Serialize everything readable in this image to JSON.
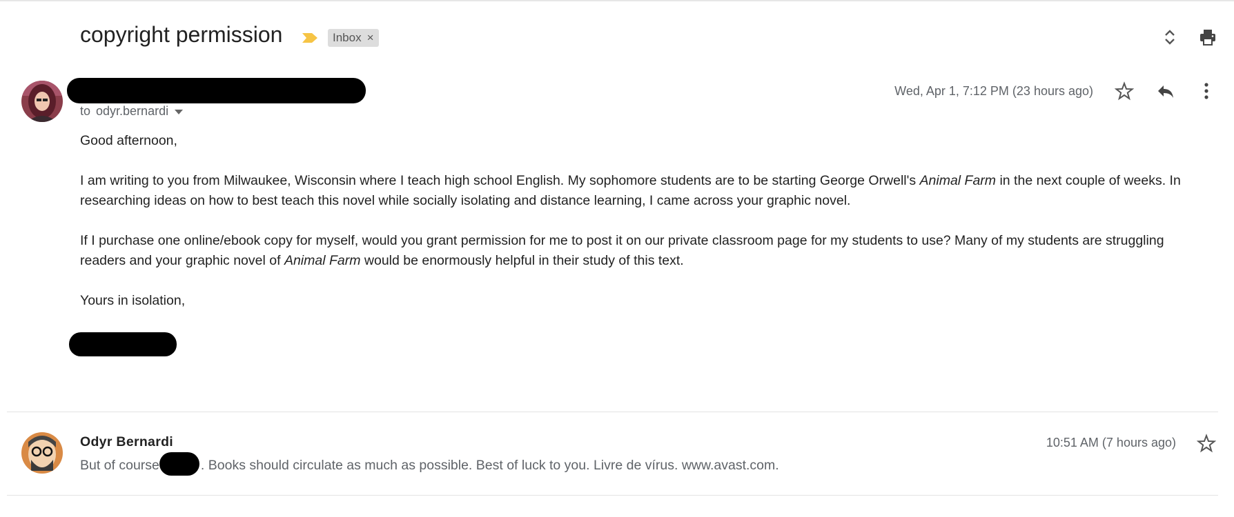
{
  "thread": {
    "subject": "copyright permission",
    "label": "Inbox",
    "label_close": "×",
    "icons": [
      "importance-marker-icon",
      "expand-collapse-icon",
      "print-icon"
    ]
  },
  "message1": {
    "to_prefix": "to",
    "recipient": "odyr.bernardi",
    "date": "Wed, Apr 1, 7:12 PM (23 hours ago)",
    "icons": [
      "star-icon",
      "reply-icon",
      "more-options-icon"
    ],
    "greeting": "Good afternoon,",
    "p1_a": "I am writing to you from Milwaukee, Wisconsin where I teach high school English.  My sophomore students are to be starting George Orwell's ",
    "p1_italic": "Animal Farm",
    "p1_b": " in the next couple of weeks. In researching ideas on how to best teach this novel while socially isolating and distance learning, I came across your graphic novel.",
    "p2_a": "If I purchase one online/ebook copy for myself, would you grant permission for me to post it on our private classroom page for my students to use?  Many of my students are struggling readers and your graphic novel of ",
    "p2_italic": "Animal Farm",
    "p2_b": " would be enormously helpful in their study of this text.",
    "closing": "Yours in isolation,"
  },
  "message2": {
    "sender": "Odyr Bernardi",
    "date": "10:51 AM (7 hours ago)",
    "snippet_a": "But of course",
    "snippet_b": ". Books should circulate as much as possible. Best of luck to you. Livre de vírus. www.avast.com."
  },
  "colors": {
    "importance": "#f6c445",
    "chip_bg": "#dddddd",
    "meta_text": "#5f6368"
  }
}
